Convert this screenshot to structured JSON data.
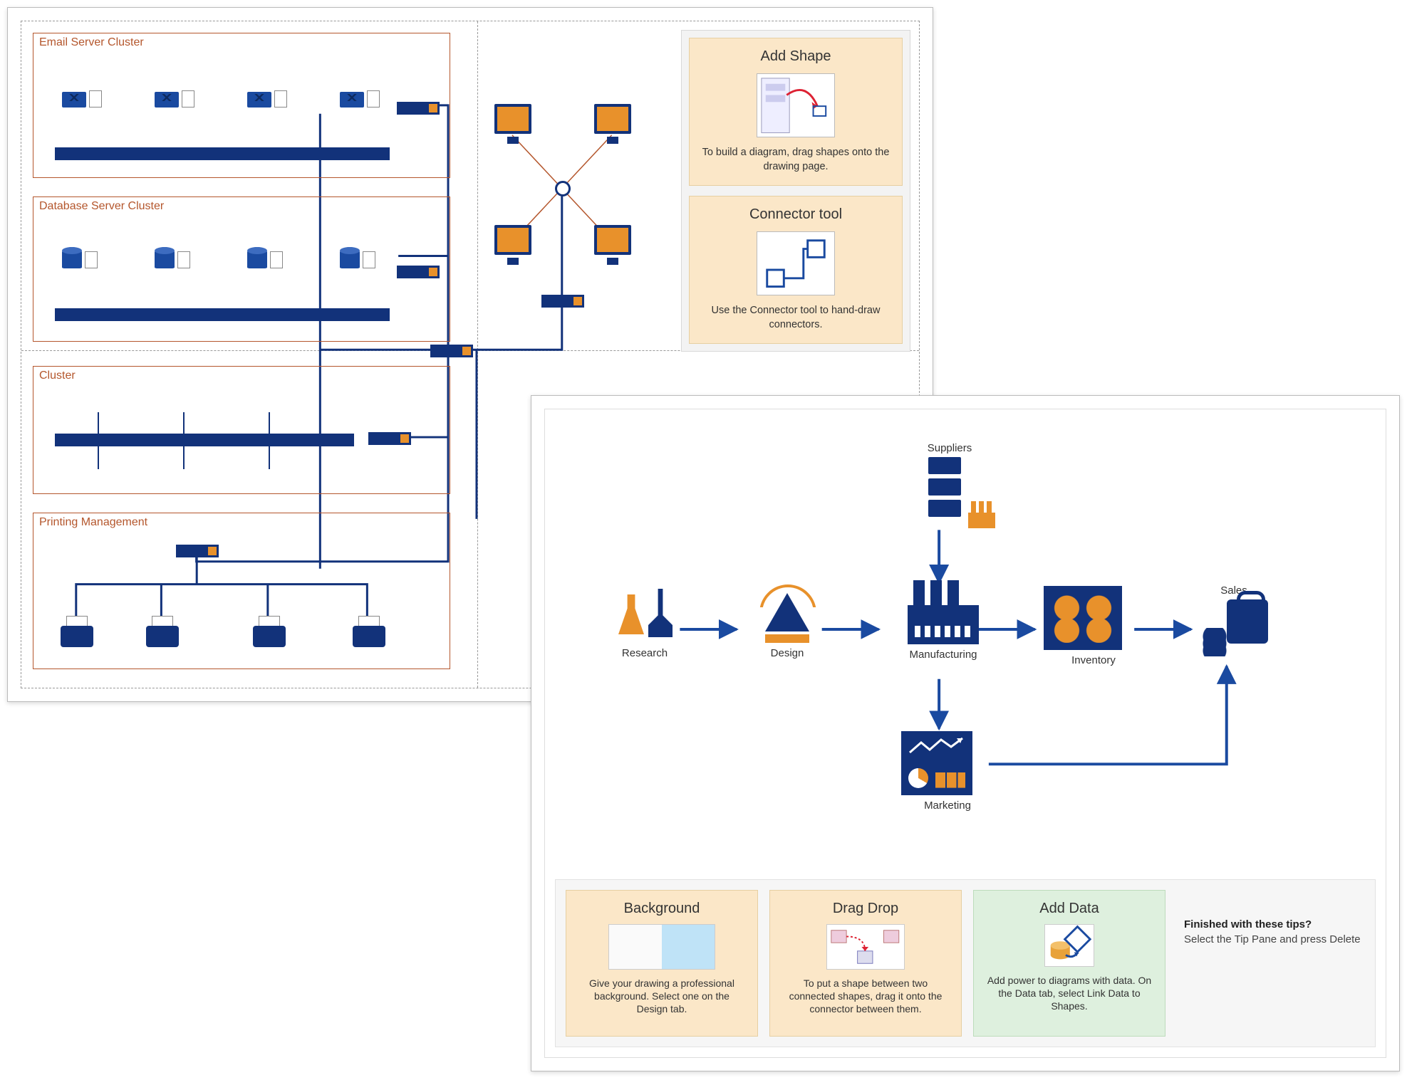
{
  "window1": {
    "clusters": {
      "email": "Email Server Cluster",
      "database": "Database Server Cluster",
      "generic": "Cluster",
      "printing": "Printing Management"
    },
    "tips": {
      "addShape": {
        "title": "Add Shape",
        "body": "To build a diagram, drag shapes onto the drawing page."
      },
      "connector": {
        "title": "Connector tool",
        "body": "Use the Connector tool to hand-draw connectors."
      }
    }
  },
  "window2": {
    "nodes": {
      "research": "Research",
      "design": "Design",
      "manufacturing": "Manufacturing",
      "inventory": "Inventory",
      "sales": "Sales",
      "suppliers": "Suppliers",
      "marketing": "Marketing"
    },
    "tips": {
      "background": {
        "title": "Background",
        "body": "Give your drawing a professional background. Select one on the Design tab."
      },
      "dragDrop": {
        "title": "Drag Drop",
        "body": "To put a shape between two connected shapes, drag it onto the connector between them."
      },
      "addData": {
        "title": "Add Data",
        "body": "Add power to diagrams with data. On the Data tab, select Link Data to Shapes."
      },
      "finish": {
        "heading": "Finished with these tips?",
        "body": "Select the Tip Pane and press Delete"
      }
    }
  }
}
